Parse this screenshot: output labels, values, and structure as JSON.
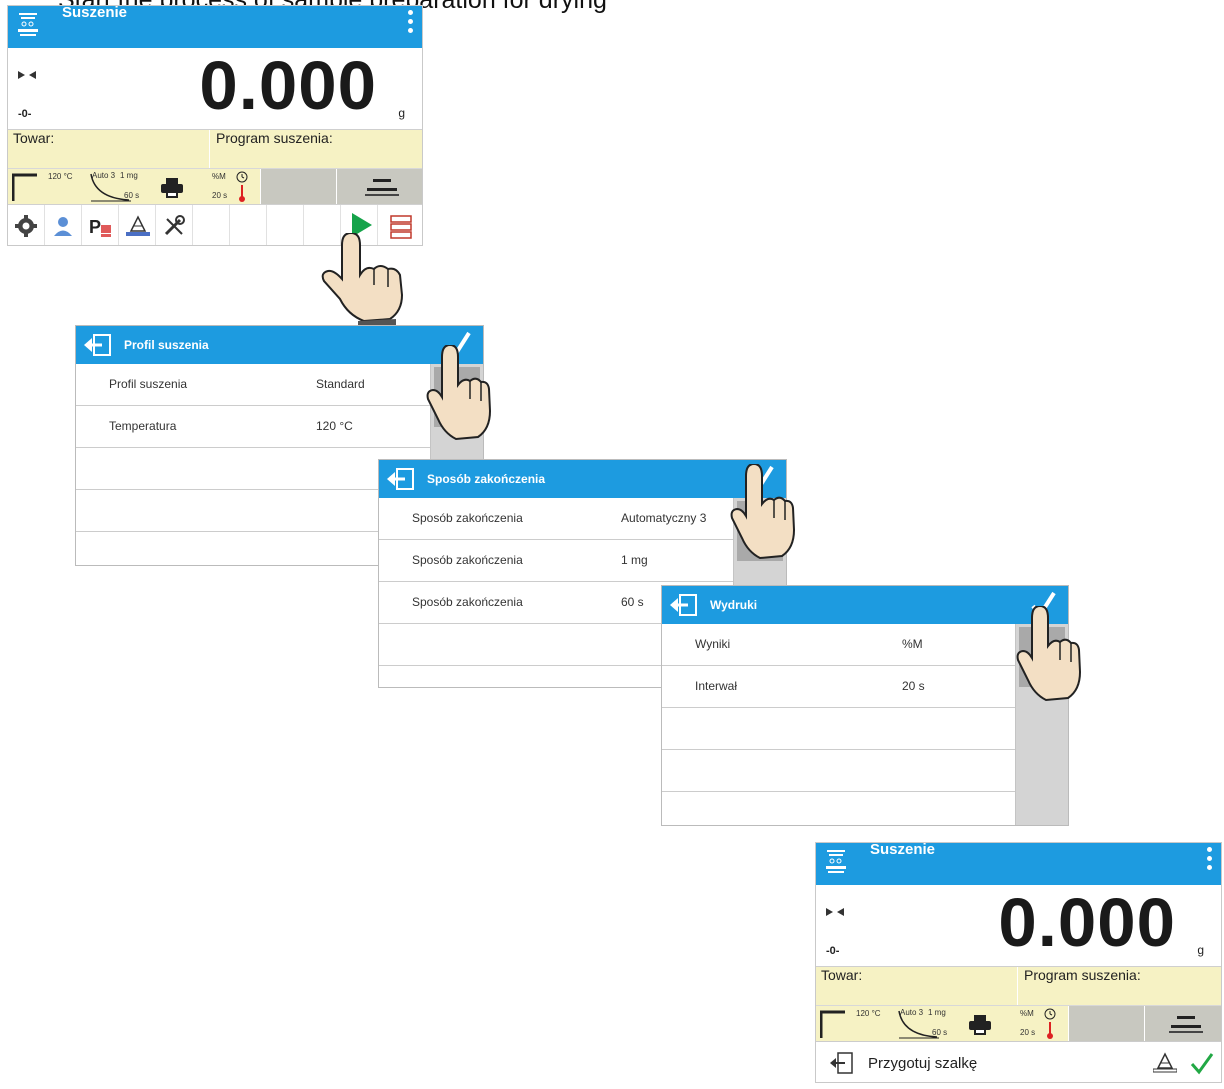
{
  "caption": "Start the process of sample preparation for drying",
  "screen1": {
    "title": "Suszenie",
    "weight": "0.000",
    "unit": "g",
    "zero_label": "-0-",
    "product_label": "Towar:",
    "program_label": "Program suszenia:",
    "tiles": {
      "temperature": "120 °C",
      "end_mode": "Auto 3",
      "end_mass": "1 mg",
      "end_time": "60 s",
      "print_result": "%M",
      "print_interval": "20 s"
    },
    "buttons": [
      "gear-icon",
      "user-icon",
      "product-icon",
      "tare-icon",
      "tools-icon",
      "",
      "",
      "",
      "start-icon",
      "database-icon"
    ]
  },
  "dialog_profile": {
    "title": "Profil suszenia",
    "rows": [
      {
        "label": "Profil suszenia",
        "value": "Standard"
      },
      {
        "label": "Temperatura",
        "value": "120 °C"
      },
      {
        "label": "",
        "value": ""
      },
      {
        "label": "",
        "value": ""
      }
    ]
  },
  "dialog_end": {
    "title": "Sposób zakończenia",
    "rows": [
      {
        "label": "Sposób zakończenia",
        "value": "Automatyczny 3"
      },
      {
        "label": "Sposób zakończenia",
        "value": "1 mg"
      },
      {
        "label": "Sposób zakończenia",
        "value": "60 s"
      },
      {
        "label": "",
        "value": ""
      }
    ]
  },
  "dialog_print": {
    "title": "Wydruki",
    "rows": [
      {
        "label": "Wyniki",
        "value": "%M"
      },
      {
        "label": "Interwał",
        "value": "20 s"
      },
      {
        "label": "",
        "value": ""
      },
      {
        "label": "",
        "value": ""
      }
    ]
  },
  "screen2": {
    "title": "Suszenie",
    "weight": "0.000",
    "unit": "g",
    "zero_label": "-0-",
    "product_label": "Towar:",
    "program_label": "Program suszenia:",
    "tiles": {
      "temperature": "120 °C",
      "end_mode": "Auto 3",
      "end_mass": "1 mg",
      "end_time": "60 s",
      "print_result": "%M",
      "print_interval": "20 s"
    },
    "prompt": "Przygotuj szalkę"
  }
}
